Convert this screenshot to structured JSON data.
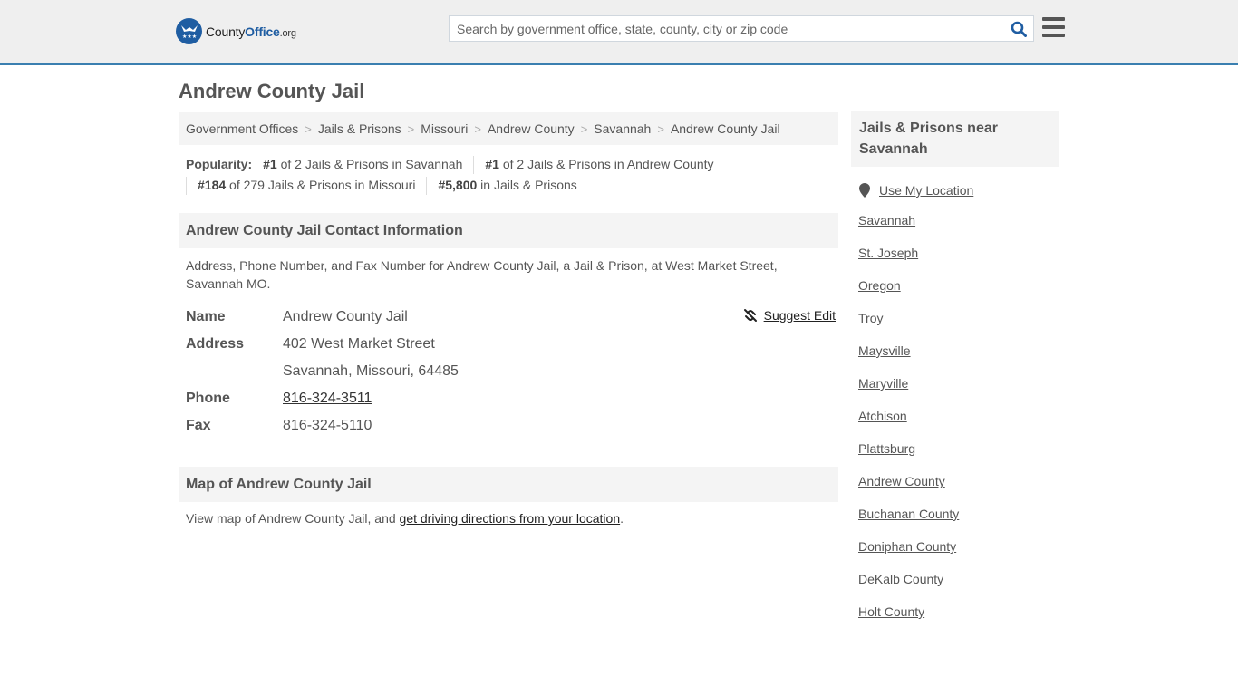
{
  "header": {
    "logo_text_main": "County",
    "logo_text_office": "Office",
    "logo_text_org": ".org",
    "search_placeholder": "Search by government office, state, county, city or zip code",
    "search_value": "",
    "brand_color": "#1f5da2",
    "accent_line_color": "#3a7fb0"
  },
  "page": {
    "title": "Andrew County Jail"
  },
  "breadcrumb": [
    {
      "label": "Government Offices"
    },
    {
      "label": "Jails & Prisons"
    },
    {
      "label": "Missouri"
    },
    {
      "label": "Andrew County"
    },
    {
      "label": "Savannah"
    },
    {
      "label": "Andrew County Jail"
    }
  ],
  "popularity": {
    "label": "Popularity:",
    "items": [
      {
        "rank": "#1",
        "text": " of 2 Jails & Prisons in Savannah"
      },
      {
        "rank": "#1",
        "text": " of 2 Jails & Prisons in Andrew County"
      },
      {
        "rank": "#184",
        "text": " of 279 Jails & Prisons in Missouri"
      },
      {
        "rank": "#5,800",
        "text": " in Jails & Prisons"
      }
    ]
  },
  "contact": {
    "heading": "Andrew County Jail Contact Information",
    "description": "Address, Phone Number, and Fax Number for Andrew County Jail, a Jail & Prison, at West Market Street, Savannah MO.",
    "suggest_edit": "Suggest Edit",
    "fields": {
      "name_label": "Name",
      "name_value": "Andrew County Jail",
      "address_label": "Address",
      "address_line1": "402 West Market Street",
      "address_line2": "Savannah, Missouri, 64485",
      "phone_label": "Phone",
      "phone_value": "816-324-3511",
      "fax_label": "Fax",
      "fax_value": "816-324-5110"
    }
  },
  "map": {
    "heading": "Map of Andrew County Jail",
    "desc_prefix": "View map of Andrew County Jail, and ",
    "desc_link": "get driving directions from your location",
    "desc_suffix": "."
  },
  "sidebar": {
    "heading": "Jails & Prisons near Savannah",
    "use_location": "Use My Location",
    "links": [
      "Savannah",
      "St. Joseph",
      "Oregon",
      "Troy",
      "Maysville",
      "Maryville",
      "Atchison",
      "Plattsburg",
      "Andrew County",
      "Buchanan County",
      "Doniphan County",
      "DeKalb County",
      "Holt County"
    ]
  }
}
